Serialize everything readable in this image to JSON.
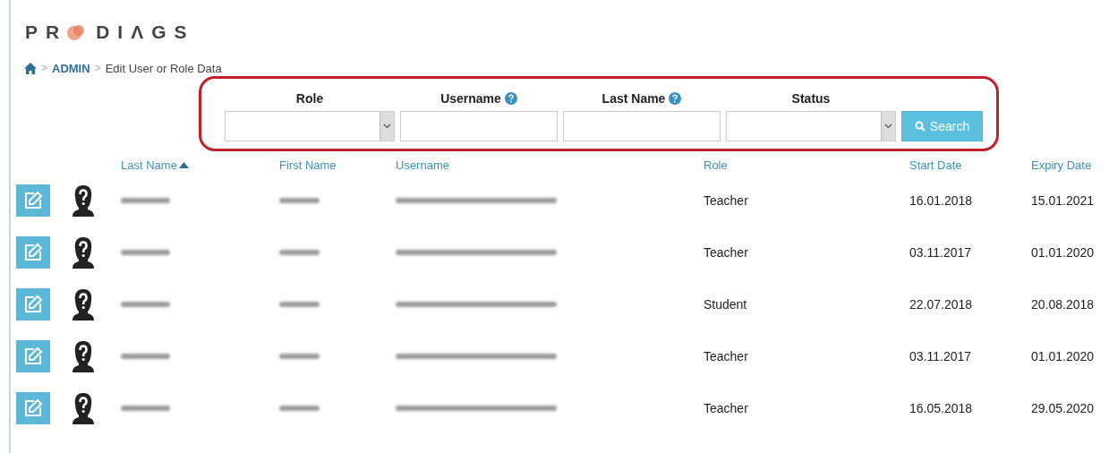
{
  "logo": {
    "before": "PR",
    "after": "DIΛGS"
  },
  "breadcrumb": [
    {
      "separator": ">",
      "label": "ADMIN",
      "kind": "link"
    },
    {
      "separator": ">",
      "label": "Edit User or Role Data",
      "kind": "current"
    }
  ],
  "filters": [
    {
      "label": "Role",
      "kind": "select",
      "help": false
    },
    {
      "label": "Username",
      "kind": "text",
      "help": true
    },
    {
      "label": "Last Name",
      "kind": "text",
      "help": true
    },
    {
      "label": "Status",
      "kind": "select",
      "help": false
    }
  ],
  "search_button": "Search",
  "table": {
    "columns": [
      {
        "label": "Last Name",
        "sorted": true
      },
      {
        "label": "First Name",
        "sorted": false
      },
      {
        "label": "Username",
        "sorted": false
      },
      {
        "label": "Role",
        "sorted": false
      },
      {
        "label": "Start Date",
        "sorted": false
      },
      {
        "label": "Expiry Date",
        "sorted": false
      }
    ],
    "rows": [
      {
        "last_name": {
          "kind": "redacted"
        },
        "first_name": {
          "kind": "redacted"
        },
        "username": {
          "kind": "redacted"
        },
        "role": "Teacher",
        "start_date": "16.01.2018",
        "expiry_date": "15.01.2021"
      },
      {
        "last_name": {
          "kind": "redacted"
        },
        "first_name": {
          "kind": "redacted"
        },
        "username": {
          "kind": "redacted"
        },
        "role": "Teacher",
        "start_date": "03.11.2017",
        "expiry_date": "01.01.2020"
      },
      {
        "last_name": {
          "kind": "redacted"
        },
        "first_name": {
          "kind": "redacted"
        },
        "username": {
          "kind": "redacted"
        },
        "role": "Student",
        "start_date": "22.07.2018",
        "expiry_date": "20.08.2018"
      },
      {
        "last_name": {
          "kind": "redacted"
        },
        "first_name": {
          "kind": "redacted"
        },
        "username": {
          "kind": "redacted"
        },
        "role": "Teacher",
        "start_date": "03.11.2017",
        "expiry_date": "01.01.2020"
      },
      {
        "last_name": {
          "kind": "redacted"
        },
        "first_name": {
          "kind": "redacted"
        },
        "username": {
          "kind": "redacted"
        },
        "role": "Teacher",
        "start_date": "16.05.2018",
        "expiry_date": "29.05.2020"
      }
    ]
  }
}
